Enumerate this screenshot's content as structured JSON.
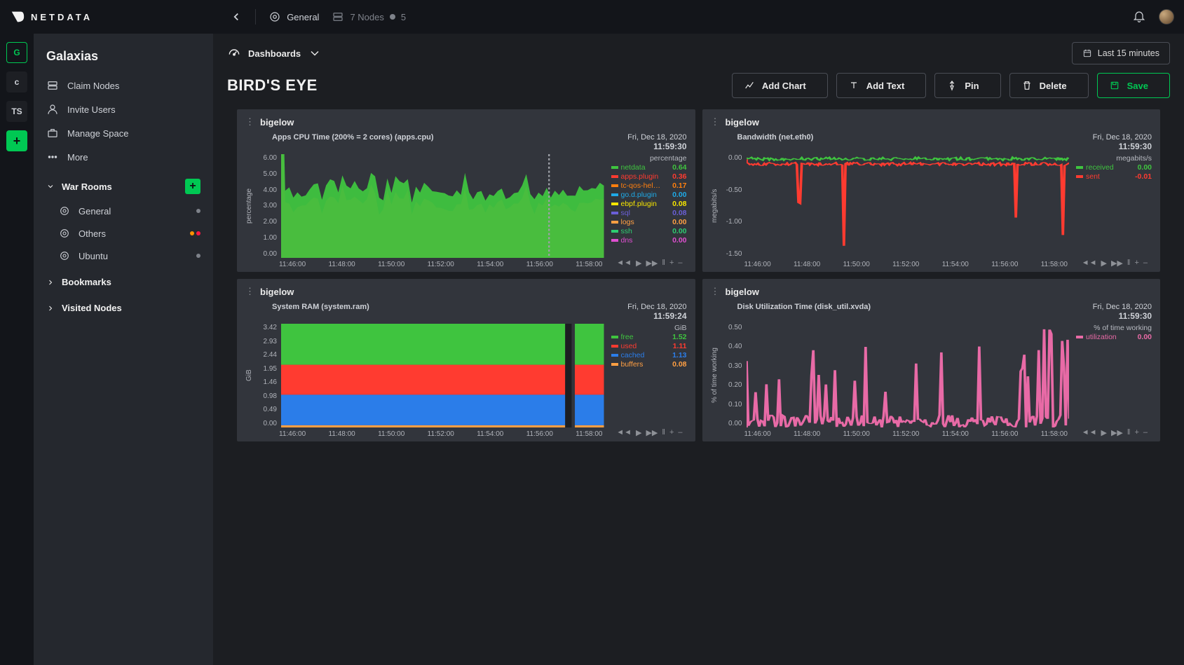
{
  "brand": "NETDATA",
  "topbar": {
    "room": "General",
    "nodes_label": "7 Nodes",
    "nodes_side": "5"
  },
  "timeframe": "Last 15 minutes",
  "rail": {
    "items": [
      "G",
      "c",
      "TS"
    ],
    "active": 0
  },
  "sidebar": {
    "title": "Galaxias",
    "links": [
      "Claim Nodes",
      "Invite Users",
      "Manage Space",
      "More"
    ],
    "war_rooms_label": "War Rooms",
    "rooms": [
      {
        "name": "General",
        "dots": [
          "#7e828a"
        ]
      },
      {
        "name": "Others",
        "dots": [
          "#ff9100",
          "#ff1744"
        ]
      },
      {
        "name": "Ubuntu",
        "dots": [
          "#7e828a"
        ]
      }
    ],
    "bookmarks_label": "Bookmarks",
    "visited_label": "Visited Nodes"
  },
  "subbar": {
    "dashboards": "Dashboards"
  },
  "page_title": "BIRD'S EYE",
  "actions": {
    "add_chart": "Add Chart",
    "add_text": "Add Text",
    "pin": "Pin",
    "delete": "Delete",
    "save": "Save"
  },
  "time_axis": [
    "11:46:00",
    "11:48:00",
    "11:50:00",
    "11:52:00",
    "11:54:00",
    "11:56:00",
    "11:58:00"
  ],
  "media_controls": [
    "◄◄",
    "▶",
    "▶▶",
    "‖",
    "+",
    "–"
  ],
  "chart_data": [
    {
      "card_title": "bigelow",
      "title": "Apps CPU Time (200% = 2 cores) (apps.cpu)",
      "timestamp_date": "Fri, Dec 18, 2020",
      "timestamp_time": "11:59:30",
      "type": "area",
      "ylabel": "percentage",
      "unit": "percentage",
      "ylim": [
        0,
        6
      ],
      "yticks": [
        "6.00",
        "5.00",
        "4.00",
        "3.00",
        "2.00",
        "1.00",
        "0.00"
      ],
      "xticks_ref": "time_axis",
      "series": [
        {
          "name": "netdata",
          "color": "#3fc43f",
          "value": "0.64"
        },
        {
          "name": "apps.plugin",
          "color": "#ff3b30",
          "value": "0.36"
        },
        {
          "name": "tc-qos-hel…",
          "color": "#ff7f0e",
          "value": "0.17"
        },
        {
          "name": "go.d.plugin",
          "color": "#1fa9e6",
          "value": "0.00"
        },
        {
          "name": "ebpf.plugin",
          "color": "#f6e500",
          "value": "0.08"
        },
        {
          "name": "sql",
          "color": "#6a5fd6",
          "value": "0.08"
        },
        {
          "name": "logs",
          "color": "#ff9f43",
          "value": "0.00"
        },
        {
          "name": "ssh",
          "color": "#2ecc71",
          "value": "0.00"
        },
        {
          "name": "dns",
          "color": "#e04fd1",
          "value": "0.00"
        }
      ]
    },
    {
      "card_title": "bigelow",
      "title": "Bandwidth (net.eth0)",
      "timestamp_date": "Fri, Dec 18, 2020",
      "timestamp_time": "11:59:30",
      "type": "area",
      "ylabel": "megabits/s",
      "unit": "megabits/s",
      "ylim": [
        -1.6,
        0.1
      ],
      "yticks": [
        "0.00",
        "-0.50",
        "-1.00",
        "-1.50"
      ],
      "xticks_ref": "time_axis",
      "series": [
        {
          "name": "received",
          "color": "#3fc43f",
          "value": "0.00"
        },
        {
          "name": "sent",
          "color": "#ff3b30",
          "value": "-0.01"
        }
      ]
    },
    {
      "card_title": "bigelow",
      "title": "System RAM (system.ram)",
      "timestamp_date": "Fri, Dec 18, 2020",
      "timestamp_time": "11:59:24",
      "type": "area",
      "ylabel": "GiB",
      "unit": "GiB",
      "ylim": [
        0,
        3.8
      ],
      "yticks": [
        "3.42",
        "2.93",
        "2.44",
        "1.95",
        "1.46",
        "0.98",
        "0.49",
        "0.00"
      ],
      "xticks_ref": "time_axis",
      "series": [
        {
          "name": "free",
          "color": "#3fc43f",
          "value": "1.52"
        },
        {
          "name": "used",
          "color": "#ff3b30",
          "value": "1.11"
        },
        {
          "name": "cached",
          "color": "#2b7de9",
          "value": "1.13"
        },
        {
          "name": "buffers",
          "color": "#ff9f43",
          "value": "0.08"
        }
      ]
    },
    {
      "card_title": "bigelow",
      "title": "Disk Utilization Time (disk_util.xvda)",
      "timestamp_date": "Fri, Dec 18, 2020",
      "timestamp_time": "11:59:30",
      "type": "line",
      "ylabel": "% of time working",
      "unit": "% of time working",
      "ylim": [
        0,
        0.5
      ],
      "yticks": [
        "0.50",
        "0.40",
        "0.30",
        "0.20",
        "0.10",
        "0.00"
      ],
      "xticks_ref": "time_axis",
      "series": [
        {
          "name": "utilization",
          "color": "#e86aa6",
          "value": "0.00"
        }
      ]
    }
  ]
}
